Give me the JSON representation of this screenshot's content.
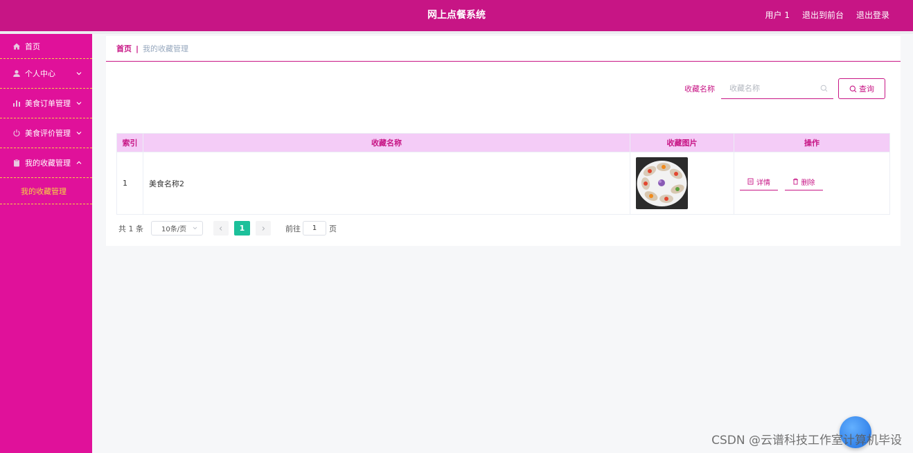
{
  "header": {
    "title": "网上点餐系统",
    "user": "用户 1",
    "to_front": "退出到前台",
    "logout": "退出登录"
  },
  "sidebar": {
    "items": [
      {
        "label": "首页",
        "icon": "home-icon"
      },
      {
        "label": "个人中心",
        "icon": "user-icon"
      },
      {
        "label": "美食订单管理",
        "icon": "bar-chart-icon"
      },
      {
        "label": "美食评价管理",
        "icon": "power-icon"
      },
      {
        "label": "我的收藏管理",
        "icon": "clipboard-icon"
      }
    ],
    "submenu": "我的收藏管理"
  },
  "breadcrumb": {
    "home": "首页",
    "sep": "|",
    "current": "我的收藏管理"
  },
  "search": {
    "label": "收藏名称",
    "placeholder": "收藏名称",
    "button": "查询"
  },
  "table": {
    "headers": [
      "索引",
      "收藏名称",
      "收藏图片",
      "操作"
    ],
    "rows": [
      {
        "index": "1",
        "name": "美食名称2",
        "detail": "详情",
        "delete": "删除"
      }
    ]
  },
  "pager": {
    "total": "共 1 条",
    "page_size": "10条/页",
    "current": "1",
    "goto_label": "前往",
    "goto_value": "1",
    "goto_suffix": "页"
  },
  "watermark": "CSDN @云谱科技工作室计算机毕设",
  "colors": {
    "primary": "#c71585",
    "sidebar": "#e0119a",
    "accent_yellow": "#f5d442",
    "table_header": "#f4ccf7",
    "pager_active": "#1cc09a"
  }
}
